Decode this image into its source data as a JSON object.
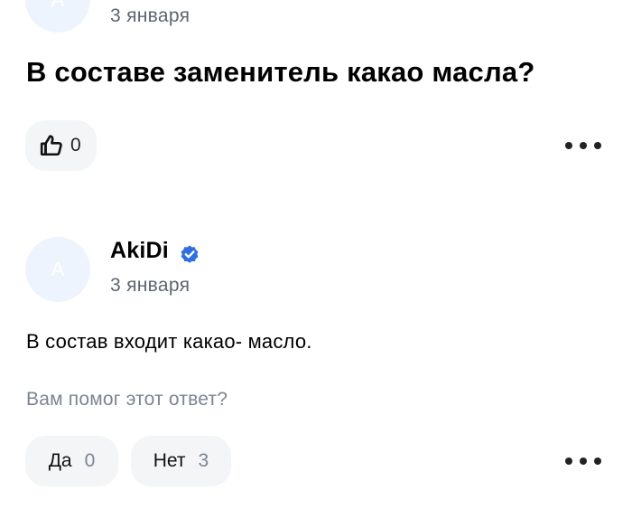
{
  "previous_answer": {
    "avatar_letter": "A",
    "date": "3 января"
  },
  "question": {
    "title": "В составе заменитель какао масла?",
    "like_count": "0",
    "like_icon": "thumbs-up-icon",
    "more_icon": "more-horizontal-icon"
  },
  "answer": {
    "avatar_letter": "A",
    "author": "AkiDi",
    "verified_icon": "verified-check-icon",
    "date": "3 января",
    "text": "В состав входит какао- масло.",
    "helpful_question": "Вам помог этот ответ?",
    "yes_label": "Да",
    "yes_count": "0",
    "no_label": "Нет",
    "no_count": "3",
    "more_icon": "more-horizontal-icon"
  },
  "colors": {
    "avatar_bg": "#eef4fd",
    "verified_blue": "#2f6fe0",
    "pill_bg": "#f4f5f7",
    "muted_text": "#7b8592"
  }
}
